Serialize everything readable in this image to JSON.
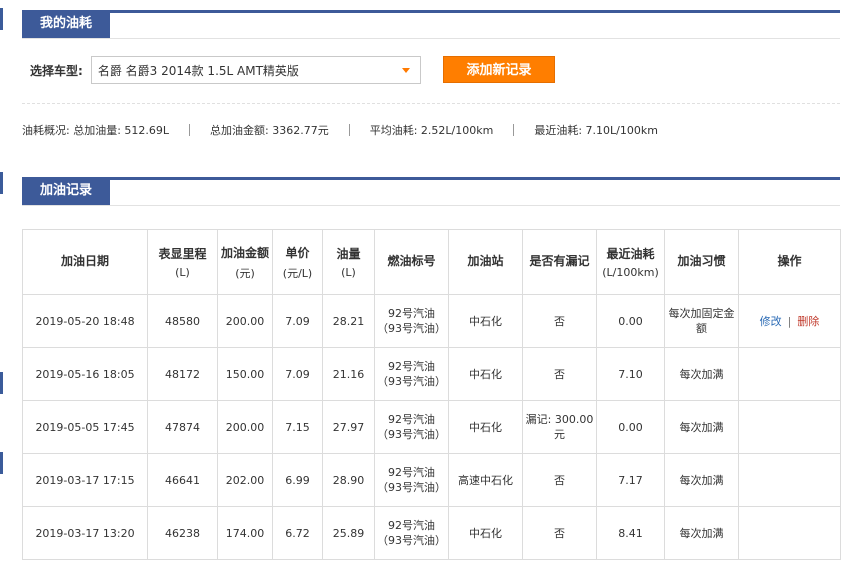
{
  "sections": {
    "my_fuel": "我的油耗",
    "records": "加油记录"
  },
  "selector": {
    "label": "选择车型:",
    "value": "名爵 名爵3 2014款 1.5L AMT精英版"
  },
  "add_button": "添加新记录",
  "summary": {
    "total_fuel": "油耗概况: 总加油量: 512.69L",
    "total_amount": "总加油金额: 3362.77元",
    "avg": "平均油耗: 2.52L/100km",
    "recent": "最近油耗: 7.10L/100km"
  },
  "table": {
    "headers": [
      {
        "main": "加油日期",
        "sub": ""
      },
      {
        "main": "表显里程",
        "sub": "(L)"
      },
      {
        "main": "加油金额",
        "sub": "(元)"
      },
      {
        "main": "单价",
        "sub": "(元/L)"
      },
      {
        "main": "油量",
        "sub": "(L)"
      },
      {
        "main": "燃油标号",
        "sub": ""
      },
      {
        "main": "加油站",
        "sub": ""
      },
      {
        "main": "是否有漏记",
        "sub": ""
      },
      {
        "main": "最近油耗",
        "sub": "(L/100km)"
      },
      {
        "main": "加油习惯",
        "sub": ""
      },
      {
        "main": "操作",
        "sub": ""
      }
    ],
    "rows": [
      {
        "date": "2019-05-20 18:48",
        "mileage": "48580",
        "amount": "200.00",
        "price": "7.09",
        "volume": "28.21",
        "grade": "92号汽油（93号汽油）",
        "station": "中石化",
        "missed": "否",
        "consumption": "0.00",
        "habit": "每次加固定金额",
        "edit": "修改",
        "sep": "|",
        "del": "删除"
      },
      {
        "date": "2019-05-16 18:05",
        "mileage": "48172",
        "amount": "150.00",
        "price": "7.09",
        "volume": "21.16",
        "grade": "92号汽油（93号汽油）",
        "station": "中石化",
        "missed": "否",
        "consumption": "7.10",
        "habit": "每次加满",
        "edit": "",
        "sep": "",
        "del": ""
      },
      {
        "date": "2019-05-05 17:45",
        "mileage": "47874",
        "amount": "200.00",
        "price": "7.15",
        "volume": "27.97",
        "grade": "92号汽油（93号汽油）",
        "station": "中石化",
        "missed": "漏记: 300.00元",
        "consumption": "0.00",
        "habit": "每次加满",
        "edit": "",
        "sep": "",
        "del": ""
      },
      {
        "date": "2019-03-17 17:15",
        "mileage": "46641",
        "amount": "202.00",
        "price": "6.99",
        "volume": "28.90",
        "grade": "92号汽油（93号汽油）",
        "station": "高速中石化",
        "missed": "否",
        "consumption": "7.17",
        "habit": "每次加满",
        "edit": "",
        "sep": "",
        "del": ""
      },
      {
        "date": "2019-03-17 13:20",
        "mileage": "46238",
        "amount": "174.00",
        "price": "6.72",
        "volume": "25.89",
        "grade": "92号汽油（93号汽油）",
        "station": "中石化",
        "missed": "否",
        "consumption": "8.41",
        "habit": "每次加满",
        "edit": "",
        "sep": "",
        "del": ""
      }
    ]
  }
}
